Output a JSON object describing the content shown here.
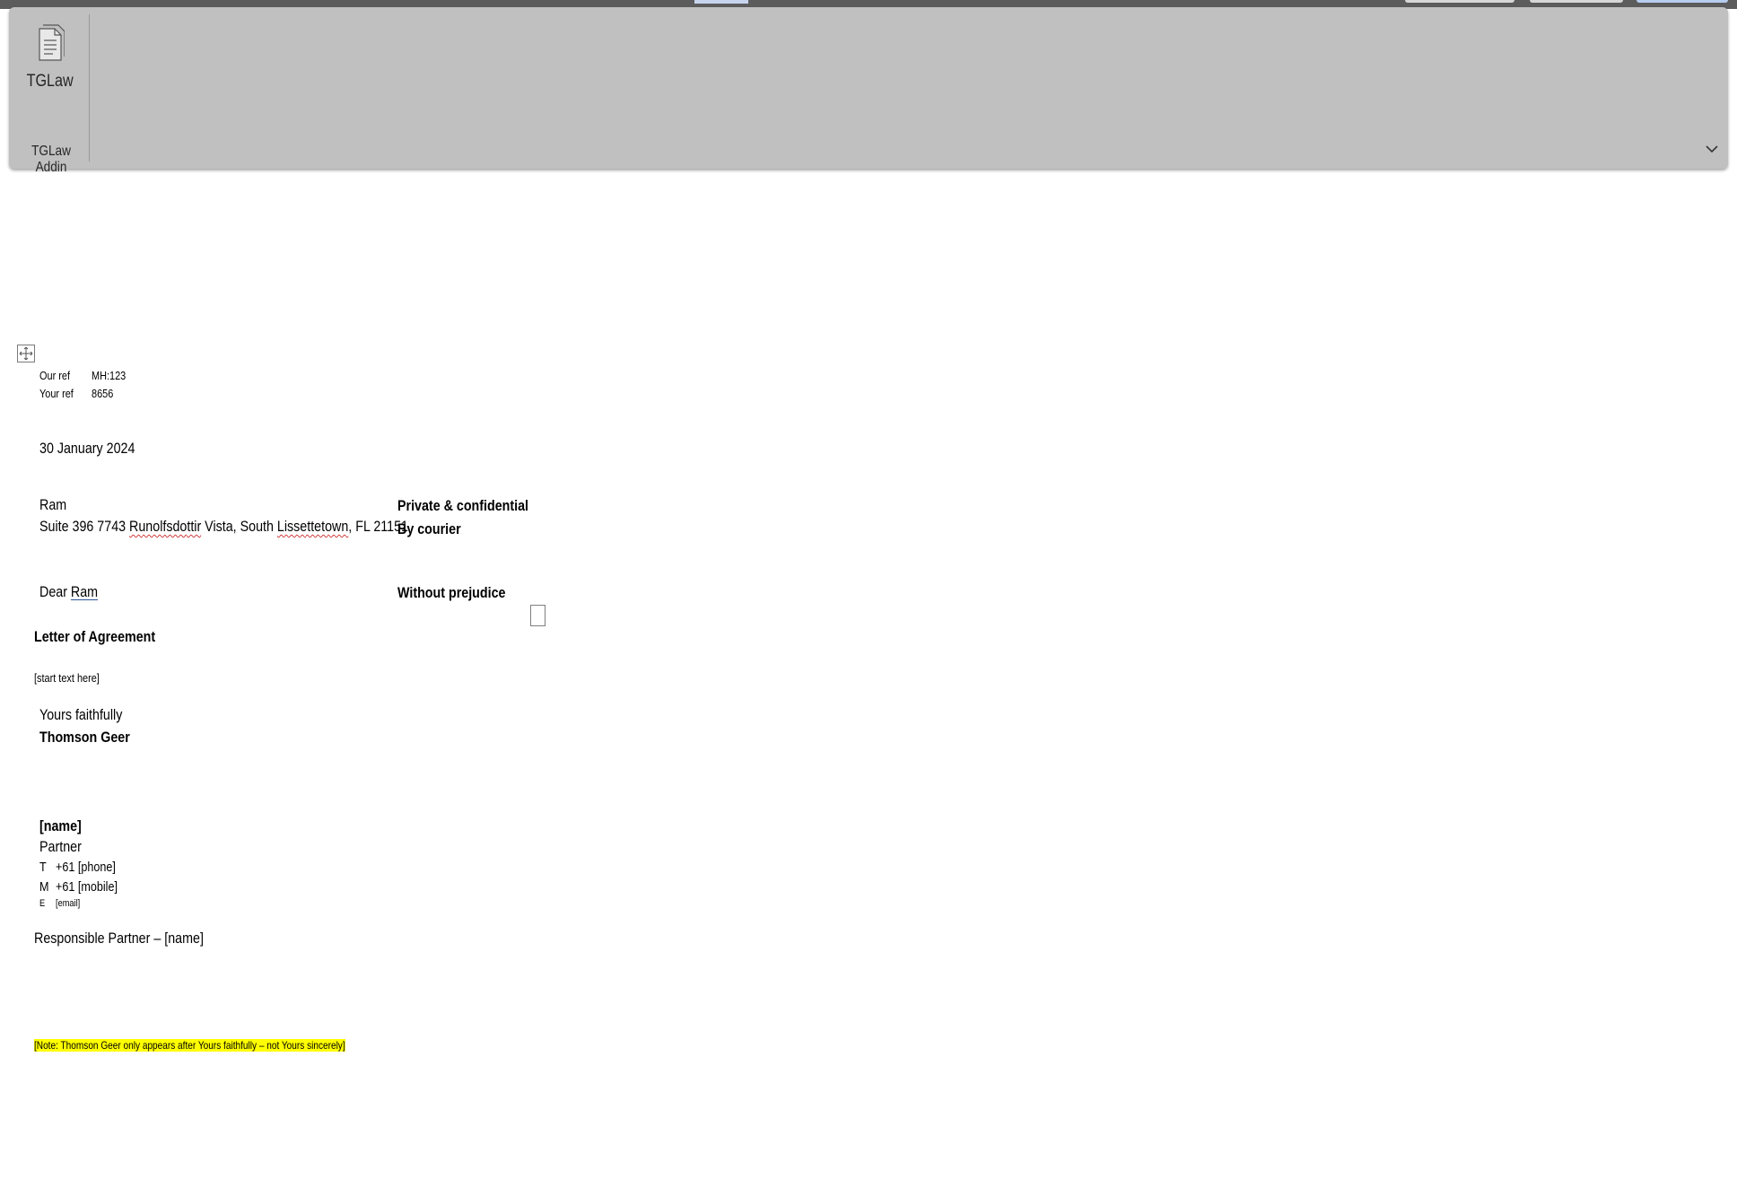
{
  "ribbon": {
    "button_label": "TGLaw",
    "group_label": "TGLaw Addin",
    "icons": {
      "addin": "document-pages-icon",
      "collapse": "chevron-down-icon",
      "move": "table-move-handle-icon"
    }
  },
  "letter": {
    "refs": {
      "our_ref_label": "Our ref",
      "our_ref_value": "MH:123",
      "your_ref_label": "Your ref",
      "your_ref_value": "8656"
    },
    "date": "30 January 2024",
    "recipient_name": "Ram",
    "address": {
      "part1": "Suite 396 7743 ",
      "street_word": "Runolfsdottir",
      "part2": " Vista, South ",
      "town_word": "Lissettetown",
      "part3": ", FL 21151"
    },
    "delivery": {
      "line1": "Private & confidential",
      "line2": "By courier"
    },
    "salutation_prefix": "Dear ",
    "salutation_name": "Ram",
    "without_prejudice": "Without prejudice",
    "subject": "Letter of Agreement",
    "body_placeholder": "[start text here]",
    "closing": "Yours faithfully",
    "firm_name": "Thomson Geer",
    "signature": {
      "name": "[name]",
      "title": "Partner",
      "phone_label": "T",
      "phone_value": "+61 [phone]",
      "mobile_label": "M",
      "mobile_value": "+61 [mobile]",
      "email_label": "E",
      "email_value": "[email]"
    },
    "responsible_partner": "Responsible Partner – [name]",
    "note": "[Note: Thomson Geer only appears after Yours faithfully – not Yours sincerely]"
  }
}
